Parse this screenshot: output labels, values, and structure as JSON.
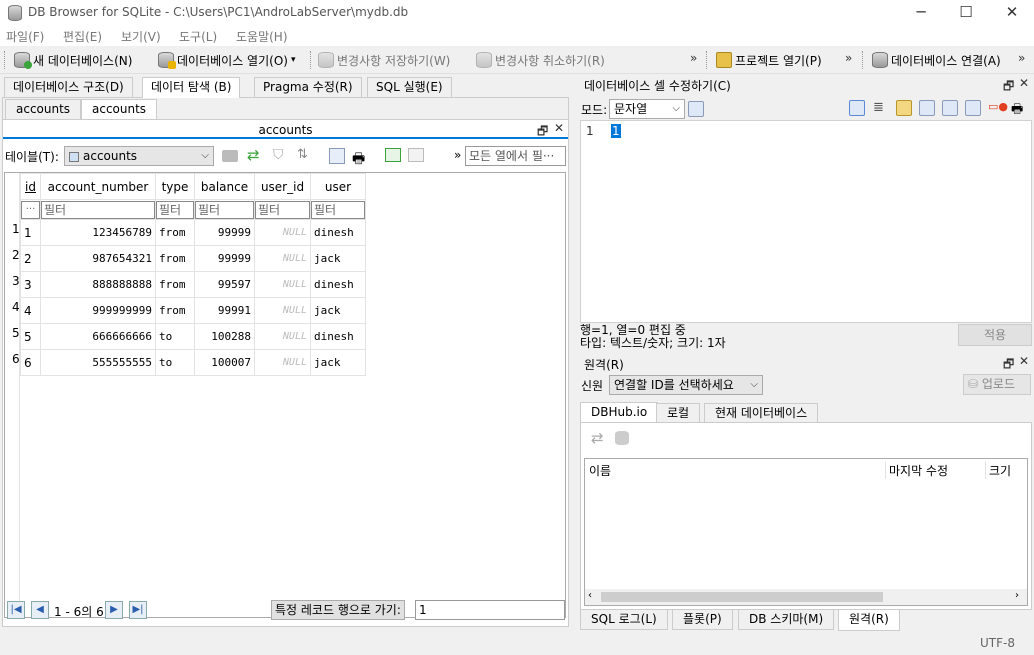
{
  "window": {
    "title": "DB Browser for SQLite - C:\\Users\\PC1\\AndroLabServer\\mydb.db",
    "controls": {
      "minimize": "─",
      "maximize": "☐",
      "close": "✕"
    }
  },
  "menu": [
    "파일(F)",
    "편집(E)",
    "보기(V)",
    "도구(L)",
    "도움말(H)"
  ],
  "toolbar": {
    "new_db": "새 데이터베이스(N)",
    "open_db": "데이터베이스 열기(O)",
    "write_changes": "변경사항 저장하기(W)",
    "revert_changes": "변경사항 취소하기(R)",
    "open_project": "프로젝트 열기(P)",
    "attach_db": "데이터베이스 연결(A)",
    "overflow": "»"
  },
  "main_tabs": [
    "데이터베이스 구조(D)",
    "데이터 탐색 (B)",
    "Pragma 수정(R)",
    "SQL 실행(E)"
  ],
  "sub_tabs": [
    "accounts",
    "accounts"
  ],
  "browse": {
    "panel_title": "accounts",
    "table_label": "테이블(T):",
    "table_selected": "accounts",
    "filter_all_placeholder": "모든 열에서 필···",
    "filter_placeholder": "필터",
    "filter_ellipsis": "···",
    "columns": [
      "id",
      "account_number",
      "type",
      "balance",
      "user_id",
      "user"
    ],
    "rows": [
      {
        "n": "1",
        "id": "1",
        "account_number": "123456789",
        "type": "from",
        "balance": "99999",
        "user_id": "NULL",
        "user": "dinesh"
      },
      {
        "n": "2",
        "id": "2",
        "account_number": "987654321",
        "type": "from",
        "balance": "99999",
        "user_id": "NULL",
        "user": "jack"
      },
      {
        "n": "3",
        "id": "3",
        "account_number": "888888888",
        "type": "from",
        "balance": "99597",
        "user_id": "NULL",
        "user": "dinesh"
      },
      {
        "n": "4",
        "id": "4",
        "account_number": "999999999",
        "type": "from",
        "balance": "99991",
        "user_id": "NULL",
        "user": "jack"
      },
      {
        "n": "5",
        "id": "5",
        "account_number": "666666666",
        "type": "to",
        "balance": "100288",
        "user_id": "NULL",
        "user": "dinesh"
      },
      {
        "n": "6",
        "id": "6",
        "account_number": "555555555",
        "type": "to",
        "balance": "100007",
        "user_id": "NULL",
        "user": "jack"
      }
    ],
    "record_info": "1 - 6의 6",
    "goto_label": "특정 레코드 행으로 가기:",
    "goto_value": "1"
  },
  "edit_cell": {
    "title": "데이터베이스 셀 수정하기(C)",
    "mode_label": "모드:",
    "mode_value": "문자열",
    "line_number": "1",
    "content": "1",
    "status_line1": "행=1, 열=0 편집 중",
    "status_line2": "타입: 텍스트/숫자; 크기: 1자",
    "apply": "적용"
  },
  "remote": {
    "title": "원격(R)",
    "identity_label": "신원",
    "identity_value": "연결할 ID를 선택하세요",
    "upload": "업로드",
    "tabs": [
      "DBHub.io",
      "로컬",
      "현재 데이터베이스"
    ],
    "columns": [
      "이름",
      "마지막 수정",
      "크기"
    ]
  },
  "bottom_tabs": [
    "SQL 로그(L)",
    "플롯(P)",
    "DB 스키마(M)",
    "원격(R)"
  ],
  "status": {
    "encoding": "UTF-8"
  },
  "colors": {
    "accent": "#0078d7",
    "grid_border": "#e3e3e3"
  }
}
